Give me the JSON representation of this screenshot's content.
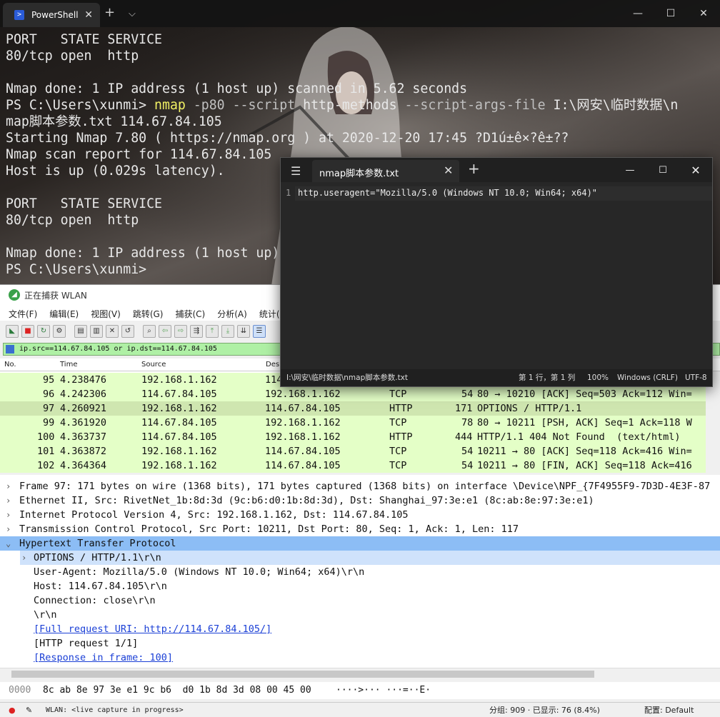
{
  "powershell": {
    "tab_title": "PowerShell",
    "new_tab_icon": "plus-icon",
    "dropdown_icon": "chevron-down-icon",
    "lines": [
      "PORT   STATE SERVICE",
      "80/tcp open  http",
      "",
      "Nmap done: 1 IP address (1 host up) scanned in 5.62 seconds",
      "",
      "map脚本参数.txt 114.67.84.105",
      "Starting Nmap 7.80 ( https://nmap.org ) at 2020-12-20 17:45 ?D1ú±ê×?ê±??",
      "Nmap scan report for 114.67.84.105",
      "Host is up (0.029s latency).",
      "",
      "PORT   STATE SERVICE",
      "80/tcp open  http",
      "",
      "Nmap done: 1 IP address (1 host up)",
      "PS C:\\Users\\xunmi>"
    ],
    "cmd_prompt": "PS C:\\Users\\xunmi> ",
    "cmd_exe": "nmap",
    "cmd_p": " -p80 ",
    "cmd_script_flag": "--script",
    "cmd_script": " http-methods ",
    "cmd_args_flag": "--script-args-file",
    "cmd_path": " I:\\网安\\临时数据\\n"
  },
  "notepad": {
    "tab_title": "nmap脚本参数.txt",
    "line_number": "1",
    "content": "http.useragent=\"Mozilla/5.0 (Windows NT 10.0; Win64; x64)\"",
    "status_path": "I:\\网安\\临时数据\\nmap脚本参数.txt",
    "status_pos": "第 1 行，第 1 列",
    "status_zoom": "100%",
    "status_eol": "Windows (CRLF)",
    "status_enc": "UTF-8"
  },
  "wireshark": {
    "title": "正在捕获 WLAN",
    "menu": [
      "文件(F)",
      "编辑(E)",
      "视图(V)",
      "跳转(G)",
      "捕获(C)",
      "分析(A)",
      "统计(S)"
    ],
    "filter": "ip.src==114.67.84.105 or ip.dst==114.67.84.105",
    "columns": [
      "No.",
      "Time",
      "Source",
      "Des"
    ],
    "packets": [
      {
        "no": "95",
        "time": "4.238476",
        "src": "192.168.1.162",
        "dst": "114",
        "proto": "",
        "len": "",
        "info": ""
      },
      {
        "no": "96",
        "time": "4.242306",
        "src": "114.67.84.105",
        "dst": "192.168.1.162",
        "proto": "TCP",
        "len": "54",
        "info": "80 → 10210 [ACK] Seq=503 Ack=112 Win="
      },
      {
        "no": "97",
        "time": "4.260921",
        "src": "192.168.1.162",
        "dst": "114.67.84.105",
        "proto": "HTTP",
        "len": "171",
        "info": "OPTIONS / HTTP/1.1"
      },
      {
        "no": "99",
        "time": "4.361920",
        "src": "114.67.84.105",
        "dst": "192.168.1.162",
        "proto": "TCP",
        "len": "78",
        "info": "80 → 10211 [PSH, ACK] Seq=1 Ack=118 W"
      },
      {
        "no": "100",
        "time": "4.363737",
        "src": "114.67.84.105",
        "dst": "192.168.1.162",
        "proto": "HTTP",
        "len": "444",
        "info": "HTTP/1.1 404 Not Found  (text/html)"
      },
      {
        "no": "101",
        "time": "4.363872",
        "src": "192.168.1.162",
        "dst": "114.67.84.105",
        "proto": "TCP",
        "len": "54",
        "info": "10211 → 80 [ACK] Seq=118 Ack=416 Win="
      },
      {
        "no": "102",
        "time": "4.364364",
        "src": "192.168.1.162",
        "dst": "114.67.84.105",
        "proto": "TCP",
        "len": "54",
        "info": "10211 → 80 [FIN, ACK] Seq=118 Ack=416"
      }
    ],
    "details": [
      "Frame 97: 171 bytes on wire (1368 bits), 171 bytes captured (1368 bits) on interface \\Device\\NPF_{7F4955F9-7D3D-4E3F-87",
      "Ethernet II, Src: RivetNet_1b:8d:3d (9c:b6:d0:1b:8d:3d), Dst: Shanghai_97:3e:e1 (8c:ab:8e:97:3e:e1)",
      "Internet Protocol Version 4, Src: 192.168.1.162, Dst: 114.67.84.105",
      "Transmission Control Protocol, Src Port: 10211, Dst Port: 80, Seq: 1, Ack: 1, Len: 117",
      "Hypertext Transfer Protocol",
      "OPTIONS / HTTP/1.1\\r\\n",
      "User-Agent: Mozilla/5.0 (Windows NT 10.0; Win64; x64)\\r\\n",
      "Host: 114.67.84.105\\r\\n",
      "Connection: close\\r\\n",
      "\\r\\n",
      "[Full request URI: http://114.67.84.105/]",
      "[HTTP request 1/1]",
      "[Response in frame: 100]"
    ],
    "bytes_offset": "0000",
    "bytes_hex": "8c ab 8e 97 3e e1 9c b6  d0 1b 8d 3d 08 00 45 00",
    "bytes_ascii": "····>··· ···=··E·",
    "status_capture": "WLAN: <live capture in progress>",
    "status_stats": "分组: 909 · 已显示: 76 (8.4%)",
    "status_profile": "配置: Default"
  }
}
